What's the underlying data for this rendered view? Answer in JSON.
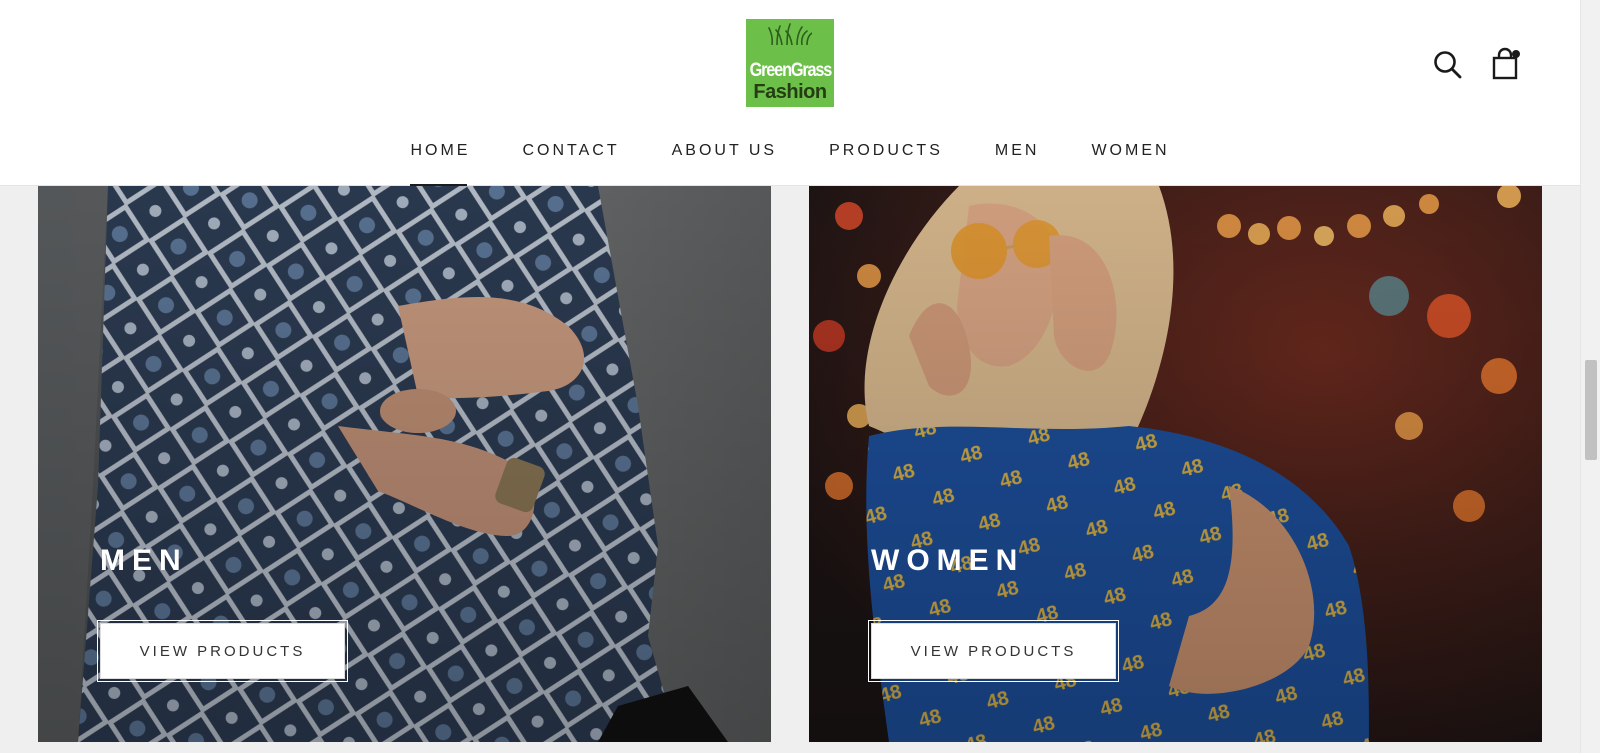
{
  "brand": {
    "logo_line1": "GreenGrass",
    "logo_line2": "Fashion",
    "logo_color": "#6cc04a"
  },
  "header": {
    "nav": [
      "HOME",
      "CONTACT",
      "ABOUT US",
      "PRODUCTS",
      "MEN",
      "WOMEN"
    ],
    "active_nav": "HOME",
    "icons": [
      "search-icon",
      "cart-icon"
    ],
    "cart_has_items": true
  },
  "collections": [
    {
      "title": "MEN",
      "button": "VIEW PRODUCTS"
    },
    {
      "title": "WOMEN",
      "button": "VIEW PRODUCTS"
    }
  ]
}
